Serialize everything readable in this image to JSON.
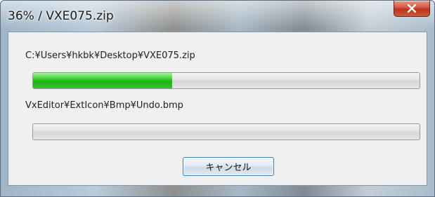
{
  "window": {
    "title": "36% / VXE075.zip",
    "close_icon": "close-x-icon"
  },
  "archive": {
    "path": "C:¥Users¥hkbk¥Desktop¥VXE075.zip",
    "overall_progress_fraction": 0.36
  },
  "current_item": {
    "path": "VxEditor¥ExtIcon¥Bmp¥Undo.bmp",
    "progress_fraction": 0
  },
  "actions": {
    "cancel_label": "キャンセル"
  },
  "colors": {
    "progress_fill": "#1fb01a",
    "close_button": "#c8442a",
    "dialog_background": "#f0f0f0"
  }
}
